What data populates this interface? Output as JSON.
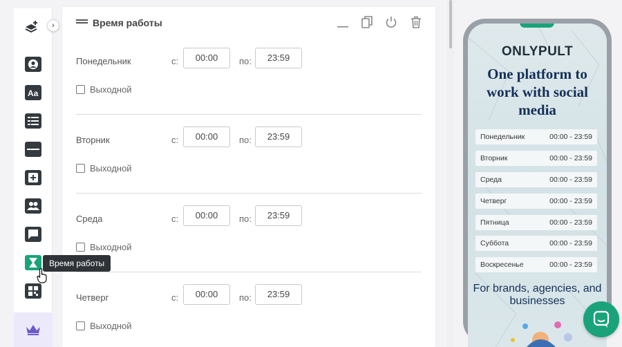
{
  "sidebar": {
    "tooltip": "Время работы",
    "icons": [
      "add-layer-icon",
      "expand-chevron-icon",
      "avatar-block-icon",
      "text-block-icon",
      "list-block-icon",
      "divider-block-icon",
      "add-block-icon",
      "team-block-icon",
      "comment-block-icon",
      "hourglass-icon",
      "qr-grid-icon",
      "crown-icon"
    ]
  },
  "panel": {
    "title": "Время работы",
    "from_label": "с:",
    "to_label": "по:",
    "dayoff_label": "Выходной",
    "days": [
      {
        "name": "Понедельник",
        "from": "00:00",
        "to": "23:59"
      },
      {
        "name": "Вторник",
        "from": "00:00",
        "to": "23:59"
      },
      {
        "name": "Среда",
        "from": "00:00",
        "to": "23:59"
      },
      {
        "name": "Четверг",
        "from": "00:00",
        "to": "23:59"
      }
    ]
  },
  "preview": {
    "brand": "ONLYPULT",
    "headline": "One platform to work with social media",
    "hours": [
      {
        "day": "Понедельник",
        "time": "00:00 - 23:59"
      },
      {
        "day": "Вторник",
        "time": "00:00 - 23:59"
      },
      {
        "day": "Среда",
        "time": "00:00 - 23:59"
      },
      {
        "day": "Четверг",
        "time": "00:00 - 23:59"
      },
      {
        "day": "Пятница",
        "time": "00:00 - 23:59"
      },
      {
        "day": "Суббота",
        "time": "00:00 - 23:59"
      },
      {
        "day": "Воскресенье",
        "time": "00:00 - 23:59"
      }
    ],
    "tagline": "For brands, agencies, and businesses"
  },
  "colors": {
    "accent": "#1aa37a",
    "dark_icon": "#333a40",
    "crown": "#6a5acd",
    "headline": "#143058"
  }
}
